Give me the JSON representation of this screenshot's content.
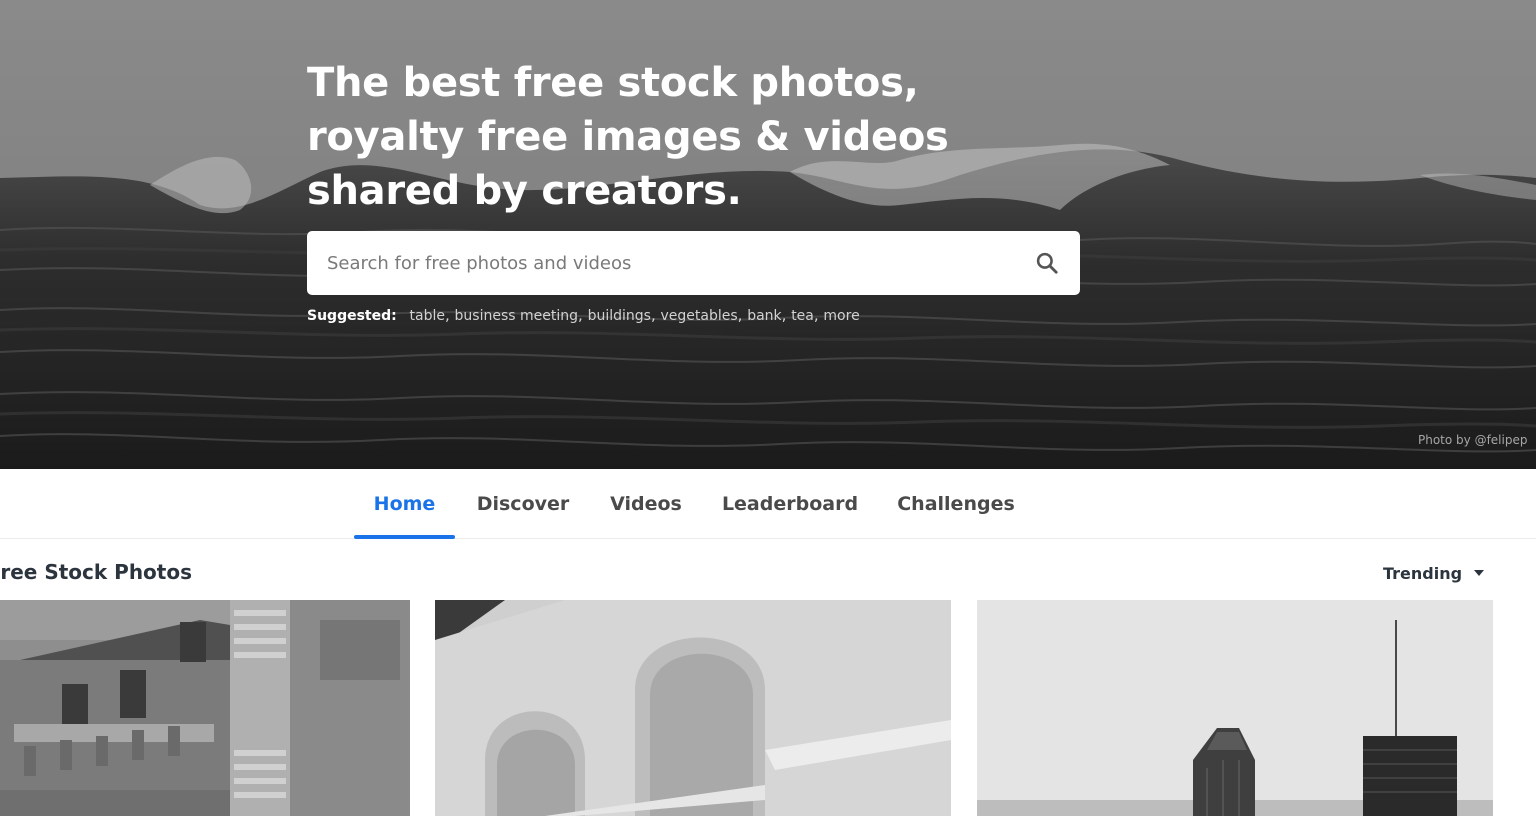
{
  "hero": {
    "title": "The best free stock photos, royalty free images & videos shared by creators.",
    "search": {
      "placeholder": "Search for free photos and videos"
    },
    "suggested": {
      "label": "Suggested:",
      "items": [
        "table",
        "business meeting",
        "buildings",
        "vegetables",
        "bank",
        "tea",
        "more"
      ]
    },
    "credit": "Photo by @felipep"
  },
  "tabs": [
    {
      "label": "Home",
      "active": true
    },
    {
      "label": "Discover",
      "active": false
    },
    {
      "label": "Videos",
      "active": false
    },
    {
      "label": "Leaderboard",
      "active": false
    },
    {
      "label": "Challenges",
      "active": false
    }
  ],
  "section": {
    "title": "Free Stock Photos",
    "sort": {
      "selected": "Trending"
    }
  },
  "photos": [
    {
      "subject": "ornate building facade"
    },
    {
      "subject": "white arches"
    },
    {
      "subject": "city skyline"
    }
  ],
  "colors": {
    "accent": "#1a73e8",
    "text_dark": "#2c343e"
  },
  "icons": {
    "search": "search-icon",
    "sort_caret": "caret-down-icon"
  }
}
